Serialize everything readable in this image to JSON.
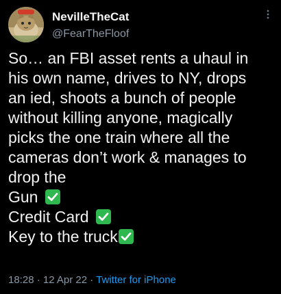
{
  "tweet": {
    "author": {
      "display_name": "NevilleTheCat",
      "handle": "@FearTheFloof",
      "avatar_icon": "cat-photo-avatar"
    },
    "more_icon": "vertical-ellipsis-icon",
    "lines": [
      "So… an FBI asset rents a uhaul in",
      "his own name, drives to NY, drops",
      "an ied, shoots a bunch of people",
      "without killing anyone, magically",
      "picks the one train where all the",
      "cameras don’t work & manages to",
      "drop the"
    ],
    "checklist": [
      {
        "label": "Gun",
        "icon": "green-check-emoji"
      },
      {
        "label": "Credit Card",
        "icon": "green-check-emoji"
      },
      {
        "label": "Key to the truck",
        "icon": "green-check-emoji"
      }
    ],
    "footer": {
      "time": "18:28",
      "separator": " · ",
      "date": "12 Apr 22",
      "source": "Twitter for iPhone"
    },
    "colors": {
      "background": "#000000",
      "text": "#e7e9ea",
      "secondary": "#8b98a5",
      "link": "#1d9bf0",
      "check_green": "#2fb84f"
    }
  }
}
